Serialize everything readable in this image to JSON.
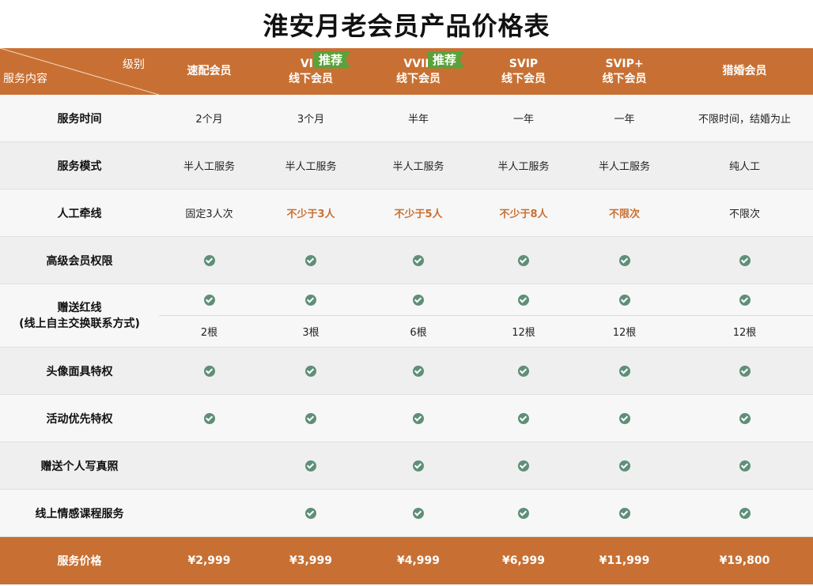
{
  "title": "淮安月老会员产品价格表",
  "header": {
    "corner_top": "级别",
    "corner_bottom": "服务内容",
    "columns": [
      {
        "line1": "速配会员",
        "line2": "",
        "badge": ""
      },
      {
        "line1": "VIP",
        "line2": "线下会员",
        "badge": "推荐"
      },
      {
        "line1": "VVIP",
        "line2": "线下会员",
        "badge": "推荐"
      },
      {
        "line1": "SVIP",
        "line2": "线下会员",
        "badge": ""
      },
      {
        "line1": "SVIP+",
        "line2": "线下会员",
        "badge": ""
      },
      {
        "line1": "猎婚会员",
        "line2": "",
        "badge": ""
      }
    ]
  },
  "rows": {
    "service_time": {
      "label": "服务时间",
      "values": [
        "2个月",
        "3个月",
        "半年",
        "一年",
        "一年",
        "不限时间，结婚为止"
      ]
    },
    "service_mode": {
      "label": "服务模式",
      "values": [
        "半人工服务",
        "半人工服务",
        "半人工服务",
        "半人工服务",
        "半人工服务",
        "纯人工"
      ]
    },
    "manual_match": {
      "label": "人工牵线",
      "values": [
        "固定3人次",
        "不少于3人",
        "不少于5人",
        "不少于8人",
        "不限次",
        "不限次"
      ]
    },
    "advanced_rights": {
      "label": "高级会员权限",
      "checks": [
        true,
        true,
        true,
        true,
        true,
        true
      ]
    },
    "gift_redline": {
      "label_line1": "赠送红线",
      "label_line2": "(线上自主交换联系方式)",
      "checks": [
        true,
        true,
        true,
        true,
        true,
        true
      ],
      "counts": [
        "2根",
        "3根",
        "6根",
        "12根",
        "12根",
        "12根"
      ]
    },
    "avatar_mask": {
      "label": "头像面具特权",
      "checks": [
        true,
        true,
        true,
        true,
        true,
        true
      ]
    },
    "activity_priority": {
      "label": "活动优先特权",
      "checks": [
        true,
        true,
        true,
        true,
        true,
        true
      ]
    },
    "gift_photo": {
      "label": "赠送个人写真照",
      "checks": [
        false,
        true,
        true,
        true,
        true,
        true
      ]
    },
    "online_course": {
      "label": "线上情感课程服务",
      "checks": [
        false,
        true,
        true,
        true,
        true,
        true
      ]
    }
  },
  "footer": {
    "label": "服务价格",
    "prices": [
      "¥2,999",
      "¥3,999",
      "¥4,999",
      "¥6,999",
      "¥11,999",
      "¥19,800"
    ]
  },
  "icons": {
    "check": "check-circle-icon"
  },
  "colors": {
    "header": "#c87033",
    "badge": "#5aa23a",
    "check": "#5f8f78",
    "highlight_text": "#c87033"
  }
}
